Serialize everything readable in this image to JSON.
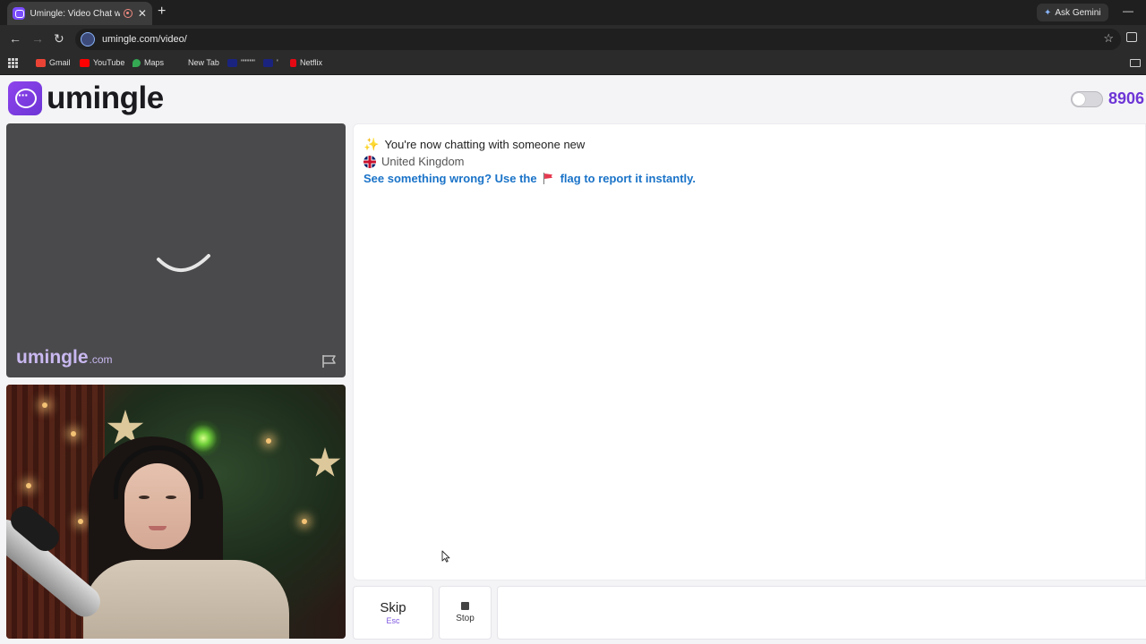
{
  "browser": {
    "tab_title": "Umingle: Video Chat with St",
    "new_tab_symbol": "+",
    "ask_gemini": "Ask Gemini",
    "url": "umingle.com/video/",
    "bookmarks": [
      {
        "label": "Gmail",
        "color": "#ea4335"
      },
      {
        "label": "YouTube",
        "color": "#ff0000"
      },
      {
        "label": "Maps",
        "color": "#34a853"
      },
      {
        "label": "New Tab",
        "color": ""
      },
      {
        "label": "\"\"\"\"\"",
        "color": "#1a237e"
      },
      {
        "label": "'",
        "color": "#1a237e"
      },
      {
        "label": "Netflix",
        "color": "#e50914"
      }
    ]
  },
  "site": {
    "logo_text": "umingle",
    "online_count": "8906",
    "accent_color": "#6d35d6"
  },
  "remote_video": {
    "state": "loading",
    "watermark_main": "umingle",
    "watermark_suffix": ".com"
  },
  "chat": {
    "status_message": "You're now chatting with someone new",
    "country": "United Kingdom",
    "report_prefix": "See something wrong? Use the",
    "report_suffix": "flag to report it instantly."
  },
  "controls": {
    "skip_label": "Skip",
    "skip_shortcut": "Esc",
    "stop_label": "Stop",
    "message_placeholder": ""
  }
}
